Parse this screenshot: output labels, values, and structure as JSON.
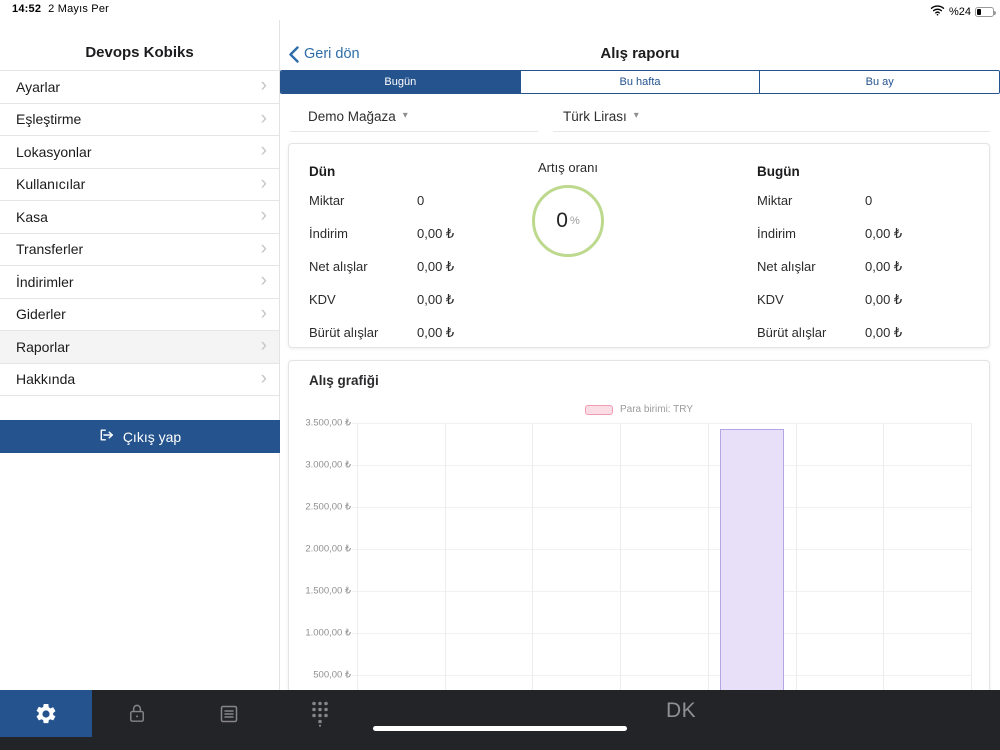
{
  "status_bar": {
    "time": "14:52",
    "date": "2 Mayıs Per",
    "battery": "%24"
  },
  "sidebar": {
    "title": "Devops Kobiks",
    "items": [
      {
        "id": "ayarlar",
        "label": "Ayarlar",
        "active": false
      },
      {
        "id": "eslestirme",
        "label": "Eşleştirme",
        "active": false
      },
      {
        "id": "lokasyonlar",
        "label": "Lokasyonlar",
        "active": false
      },
      {
        "id": "kullanicilar",
        "label": "Kullanıcılar",
        "active": false
      },
      {
        "id": "kasa",
        "label": "Kasa",
        "active": false
      },
      {
        "id": "transferler",
        "label": "Transferler",
        "active": false
      },
      {
        "id": "indirimler",
        "label": "İndirimler",
        "active": false
      },
      {
        "id": "giderler",
        "label": "Giderler",
        "active": false
      },
      {
        "id": "raporlar",
        "label": "Raporlar",
        "active": true
      },
      {
        "id": "hakkinda",
        "label": "Hakkında",
        "active": false
      }
    ],
    "logout_label": "Çıkış yap"
  },
  "header": {
    "back_label": "Geri dön",
    "title": "Alış raporu"
  },
  "tabs": [
    {
      "label": "Bugün",
      "selected": true
    },
    {
      "label": "Bu hafta",
      "selected": false
    },
    {
      "label": "Bu ay",
      "selected": false
    }
  ],
  "filters": {
    "store": "Demo Mağaza",
    "currency": "Türk Lirası"
  },
  "summary": {
    "left": {
      "title": "Dün",
      "rows": [
        {
          "label": "Miktar",
          "value": "0"
        },
        {
          "label": "İndirim",
          "value": "0,00 ₺"
        },
        {
          "label": "Net alışlar",
          "value": "0,00 ₺"
        },
        {
          "label": "KDV",
          "value": "0,00 ₺"
        },
        {
          "label": "Bürüt alışlar",
          "value": "0,00 ₺"
        }
      ]
    },
    "growth": {
      "label": "Artış oranı",
      "value": "0",
      "unit": "%"
    },
    "right": {
      "title": "Bugün",
      "rows": [
        {
          "label": "Miktar",
          "value": "0"
        },
        {
          "label": "İndirim",
          "value": "0,00 ₺"
        },
        {
          "label": "Net alışlar",
          "value": "0,00 ₺"
        },
        {
          "label": "KDV",
          "value": "0,00 ₺"
        },
        {
          "label": "Bürüt alışlar",
          "value": "0,00 ₺"
        }
      ]
    }
  },
  "chart_data": {
    "type": "bar",
    "title": "Alış grafiği",
    "legend": [
      {
        "label": "Para birimi: TRY",
        "swatch_fill": "#fbdde6",
        "swatch_border": "#f09cb4"
      }
    ],
    "categories": [
      "",
      "",
      "",
      "",
      "",
      "",
      ""
    ],
    "values": [
      0,
      0,
      0,
      0,
      3430,
      0,
      0
    ],
    "xlabel": "",
    "ylabel": "",
    "ylim": [
      0,
      3500
    ],
    "grid": true,
    "y_ticks": [
      {
        "value": 3500,
        "label": "3.500,00 ₺"
      },
      {
        "value": 3000,
        "label": "3.000,00 ₺"
      },
      {
        "value": 2500,
        "label": "2.500,00 ₺"
      },
      {
        "value": 2000,
        "label": "2.000,00 ₺"
      },
      {
        "value": 1500,
        "label": "1.500,00 ₺"
      },
      {
        "value": 1000,
        "label": "1.000,00 ₺"
      },
      {
        "value": 500,
        "label": "500,00 ₺"
      }
    ],
    "bar_fill": "#e7e0f8",
    "bar_border": "#b6a5e5"
  },
  "dock": {
    "label": "DK"
  },
  "colors": {
    "navy": "#24538E",
    "link_blue": "#2E6DA8",
    "growth_ring": "#bcd98e",
    "dock_bg": "#232428"
  }
}
